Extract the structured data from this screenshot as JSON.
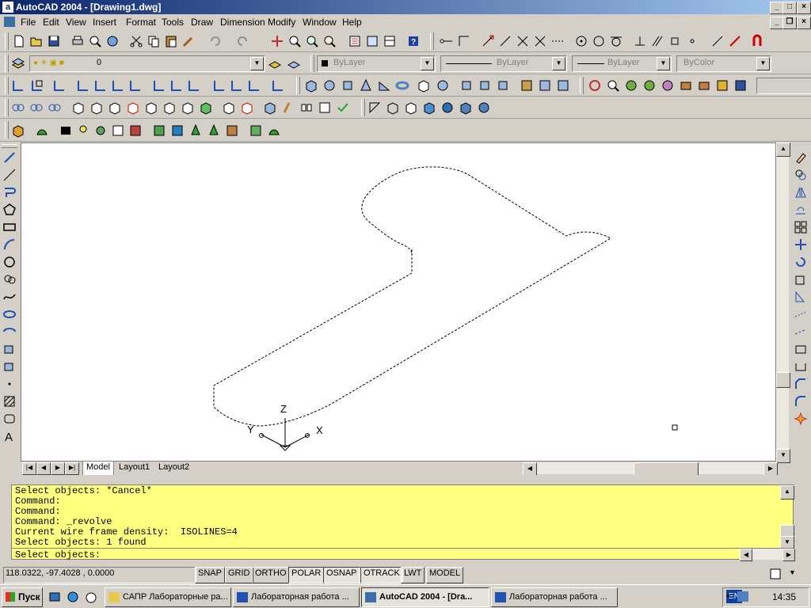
{
  "window": {
    "title": "AutoCAD 2004 - [Drawing1.dwg]",
    "app_icon": "a"
  },
  "menu": [
    "File",
    "Edit",
    "View",
    "Insert",
    "Format",
    "Tools",
    "Draw",
    "Dimension",
    "Modify",
    "Window",
    "Help"
  ],
  "properties": {
    "layer": "0",
    "color": "ByLayer",
    "linetype": "ByLayer",
    "lineweight": "ByLayer",
    "plotstyle": "ByColor"
  },
  "ucs": {
    "x": "X",
    "y": "Y",
    "z": "Z"
  },
  "layout_tabs": [
    "Model",
    "Layout1",
    "Layout2"
  ],
  "command_history": [
    "Select objects: *Cancel*",
    "Command:",
    "Command:",
    "Command: _revolve",
    "Current wire frame density:  ISOLINES=4",
    "Select objects: 1 found"
  ],
  "command_prompt": "Select objects:",
  "status": {
    "coords": "118.0322, -97.4028 , 0.0000",
    "toggles": [
      "SNAP",
      "GRID",
      "ORTHO",
      "POLAR",
      "OSNAP",
      "OTRACK",
      "LWT",
      "MODEL"
    ]
  },
  "taskbar": {
    "start": "Пуск",
    "tasks": [
      {
        "label": "САПР Лабораторные ра...",
        "active": false
      },
      {
        "label": "Лабораторная работа ...",
        "active": false
      },
      {
        "label": "AutoCAD 2004 - [Dra...",
        "active": true
      },
      {
        "label": "Лабораторная работа ...",
        "active": false
      }
    ],
    "lang": "EN",
    "clock": "14:35"
  }
}
